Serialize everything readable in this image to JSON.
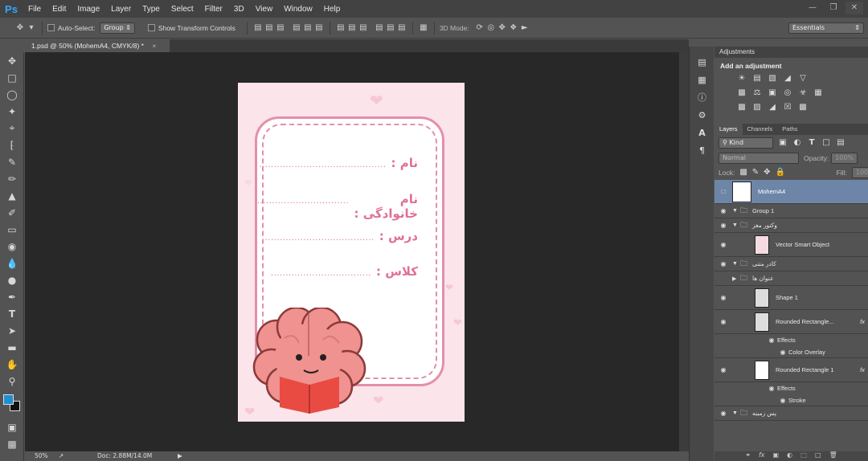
{
  "app": {
    "logo": "Ps",
    "menus": [
      "File",
      "Edit",
      "Image",
      "Layer",
      "Type",
      "Select",
      "Filter",
      "3D",
      "View",
      "Window",
      "Help"
    ],
    "window_controls": [
      "minimize-icon",
      "restore-icon",
      "close-icon"
    ]
  },
  "options": {
    "auto_select_label": "Auto-Select:",
    "auto_select_value": "Group",
    "transform_controls_label": "Show Transform Controls",
    "mode_3d_label": "3D Mode:",
    "workspace": "Essentials"
  },
  "document": {
    "tab_title": "1.psd @ 50% (MohemA4, CMYK/8) *",
    "zoom": "50%",
    "doc_size": "Doc: 2.88M/14.0M",
    "fields": [
      {
        "label": "نام :",
        "dots": "..........................................."
      },
      {
        "label": "نام خانوادگی :",
        "dots": "..............................."
      },
      {
        "label": "درس :",
        "dots": "....................................."
      },
      {
        "label": "کلاس :",
        "dots": ".................................."
      }
    ],
    "colors": {
      "accent": "#e07094",
      "border": "#e48fac",
      "background": "#fbe4ea",
      "brain": "#f0928f",
      "book": "#e94b43"
    }
  },
  "tools": [
    "move-tool",
    "marquee-tool",
    "lasso-tool",
    "magic-wand-tool",
    "crop-tool",
    "eyedropper-tool",
    "healing-brush-tool",
    "brush-tool",
    "clone-stamp-tool",
    "history-brush-tool",
    "eraser-tool",
    "paint-bucket-tool",
    "blur-tool",
    "dodge-tool",
    "pen-tool",
    "type-tool",
    "path-selection-tool",
    "rectangle-tool",
    "hand-tool",
    "zoom-tool"
  ],
  "adjustments": {
    "panel_title": "Adjustments",
    "add_label": "Add an adjustment"
  },
  "layers_panel": {
    "tabs": [
      "Layers",
      "Channels",
      "Paths"
    ],
    "filter_kind": "Kind",
    "blend_mode": "Normal",
    "opacity_label": "Opacity:",
    "opacity_value": "100%",
    "lock_label": "Lock:",
    "fill_label": "Fill:",
    "fill_value": "100%",
    "layers": [
      {
        "name": "MohemA4",
        "type": "smart",
        "selected": true
      },
      {
        "name": "Group 1",
        "type": "group"
      },
      {
        "name": "وکتور مغز",
        "type": "group"
      },
      {
        "name": "Vector Smart Object",
        "type": "smart"
      },
      {
        "name": "کادر متنی",
        "type": "group"
      },
      {
        "name": "عنوان ها",
        "type": "group"
      },
      {
        "name": "Shape 1",
        "type": "shape"
      },
      {
        "name": "Rounded Rectangle...",
        "type": "shape",
        "fx": "fx"
      },
      {
        "name": "Effects",
        "type": "effect"
      },
      {
        "name": "Color Overlay",
        "type": "effect"
      },
      {
        "name": "Rounded Rectangle 1",
        "type": "shape",
        "fx": "fx"
      },
      {
        "name": "Effects",
        "type": "effect"
      },
      {
        "name": "Stroke",
        "type": "effect"
      },
      {
        "name": "پس زمینه",
        "type": "group"
      }
    ]
  }
}
